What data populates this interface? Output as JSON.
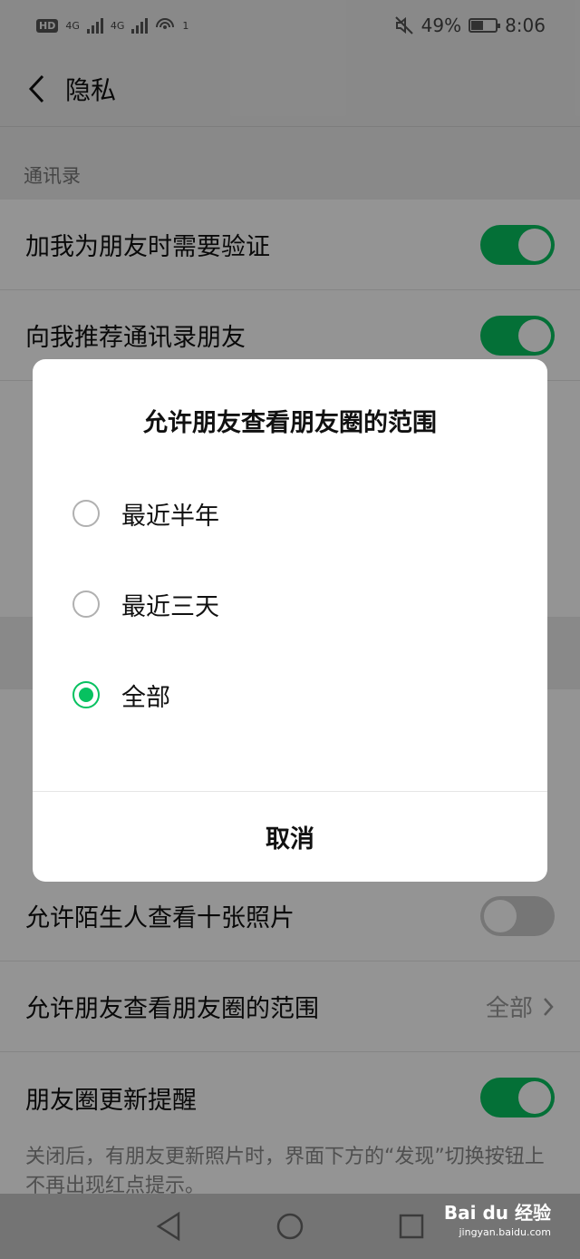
{
  "status_bar": {
    "hd": "HD",
    "net1": "4G",
    "net2": "4G",
    "hotspot_count": "1",
    "battery_percent": "49%",
    "battery_level": 0.49,
    "time": "8:06"
  },
  "header": {
    "title": "隐私"
  },
  "sections": {
    "contacts_label": "通讯录"
  },
  "settings": {
    "verify_friends": {
      "label": "加我为朋友时需要验证",
      "on": true
    },
    "recommend_contacts": {
      "label": "向我推荐通讯录朋友",
      "on": true
    },
    "strangers_ten_photos": {
      "label": "允许陌生人查看十张照片",
      "on": false
    },
    "moments_range": {
      "label": "允许朋友查看朋友圈的范围",
      "value": "全部"
    },
    "moments_update_reminder": {
      "label": "朋友圈更新提醒",
      "on": true
    },
    "moments_update_note": "关闭后，有朋友更新照片时，界面下方的“发现”切换按钮上不再出现红点提示。"
  },
  "dialog": {
    "title": "允许朋友查看朋友圈的范围",
    "options": [
      {
        "label": "最近半年",
        "checked": false
      },
      {
        "label": "最近三天",
        "checked": false
      },
      {
        "label": "全部",
        "checked": true
      }
    ],
    "cancel_label": "取消"
  },
  "watermark": {
    "brand": "Bai du 经验",
    "url": "jingyan.baidu.com"
  },
  "colors": {
    "accent": "#07c160",
    "background": "#ededed",
    "overlay": "rgba(0,0,0,0.42)"
  }
}
